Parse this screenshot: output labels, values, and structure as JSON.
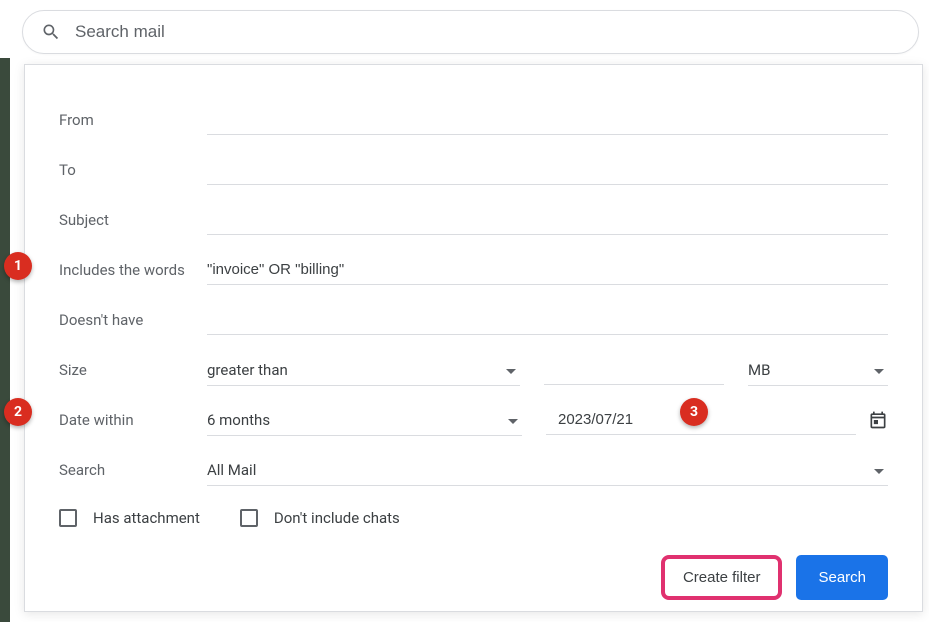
{
  "search": {
    "placeholder": "Search mail"
  },
  "fields": {
    "from": {
      "label": "From",
      "value": ""
    },
    "to": {
      "label": "To",
      "value": ""
    },
    "subject": {
      "label": "Subject",
      "value": ""
    },
    "includes": {
      "label": "Includes the words",
      "value": "\"invoice\" OR \"billing\""
    },
    "doesnt_have": {
      "label": "Doesn't have",
      "value": ""
    },
    "size": {
      "label": "Size",
      "operator": "greater than",
      "value": "",
      "unit": "MB"
    },
    "date": {
      "label": "Date within",
      "range": "6 months",
      "value": "2023/07/21"
    },
    "search_in": {
      "label": "Search",
      "value": "All Mail"
    }
  },
  "checkboxes": {
    "has_attachment": {
      "label": "Has attachment",
      "checked": false
    },
    "no_chats": {
      "label": "Don't include chats",
      "checked": false
    }
  },
  "buttons": {
    "create_filter": "Create filter",
    "search": "Search"
  },
  "annotations": {
    "b1": "1",
    "b2": "2",
    "b3": "3"
  }
}
